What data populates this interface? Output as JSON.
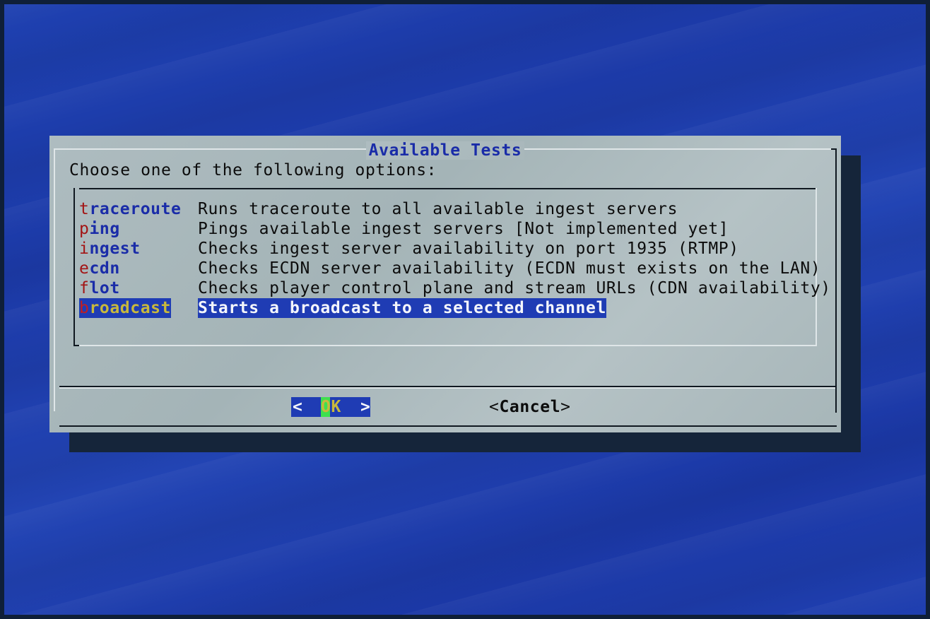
{
  "dialog": {
    "title": "Available Tests",
    "prompt": "Choose one of the following options:",
    "items": [
      {
        "hotkey": "t",
        "tag_rest": "raceroute",
        "description": "Runs traceroute to all available ingest servers"
      },
      {
        "hotkey": "p",
        "tag_rest": "ing",
        "description": "Pings available ingest servers [Not implemented yet]"
      },
      {
        "hotkey": "i",
        "tag_rest": "ngest",
        "description": "Checks ingest server availability on port 1935 (RTMP)"
      },
      {
        "hotkey": "e",
        "tag_rest": "cdn",
        "description": "Checks ECDN server availability (ECDN must exists on the LAN)"
      },
      {
        "hotkey": "f",
        "tag_rest": "lot",
        "description": "Checks player control plane and stream URLs (CDN availability)"
      },
      {
        "hotkey": "b",
        "tag_rest": "roadcast",
        "description": "Starts a broadcast to a selected channel",
        "selected": true
      }
    ],
    "buttons": {
      "ok": {
        "left": "<",
        "hotkey": "O",
        "rest": "K",
        "right": ">"
      },
      "cancel": {
        "left": "<",
        "label": "Cancel",
        "right": ">"
      }
    }
  },
  "colors": {
    "background": "#1e40b0",
    "dialog": "#aebcc0",
    "title": "#1a2ca8",
    "hotkey": "#a31515",
    "selection": "#1f3cb4",
    "selected_tag": "#c9b93c",
    "cursor": "#3fe04f"
  }
}
